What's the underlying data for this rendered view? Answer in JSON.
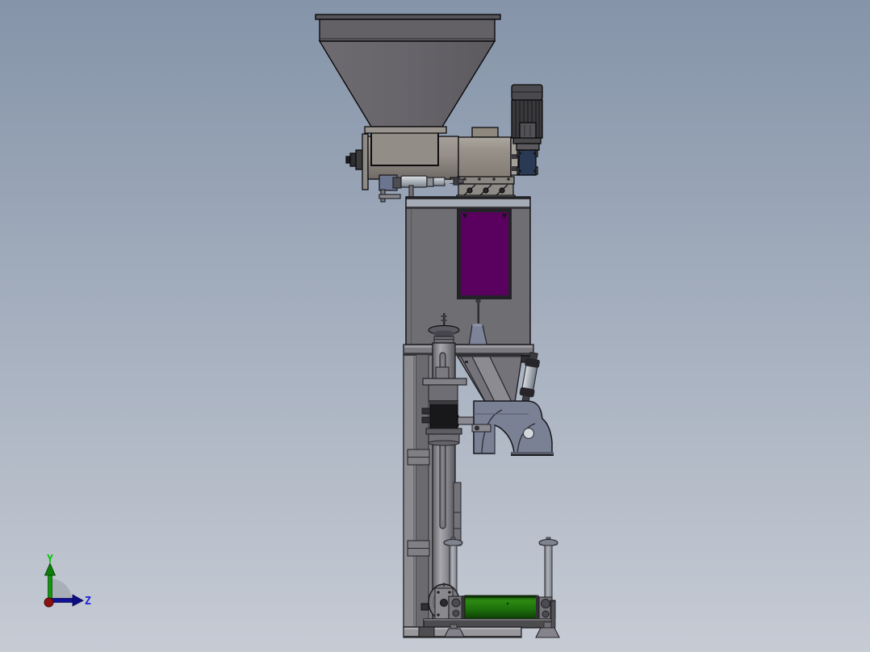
{
  "viewport": {
    "app": "3d-cad-viewport",
    "background_top": "#8594a9",
    "background_bottom": "#c6cbd4"
  },
  "axis_triad": {
    "y_label": "Y",
    "z_label": "Z",
    "y_color": "#00c800",
    "z_color": "#2222dd",
    "y_arrow_color": "#12950f",
    "z_arrow_color": "#111196",
    "origin_color": "#8c1212"
  },
  "machine": {
    "description_labels": {
      "hopper": "feed hopper",
      "trough": "screw feeder trough",
      "motor": "drive motor",
      "gearbox": "gear reducer",
      "weigher": "weigher body",
      "window": "sight window",
      "chute": "discharge chute",
      "tube": "bag spout tube",
      "conveyor": "bag conveyor"
    },
    "colors": {
      "hopper_gray": "#666468",
      "trough_beige": "#9a948e",
      "motor_dark": "#39393c",
      "gearbox_blue": "#2a3954",
      "body_gray": "#6f6e72",
      "window_purple": "#5a0160",
      "window_frame": "#232227",
      "chute_gray": "#74737a",
      "arm_slate": "#7b8194",
      "tube_gray": "#8f8e94",
      "frame_gray": "#8c8b8f",
      "conveyor_green_light": "#2e8a12",
      "conveyor_green_mid": "#1d700c",
      "conveyor_green_dark": "#0b3604",
      "base_gray": "#98979c",
      "cylinder_silver": "#c3c7cd"
    }
  }
}
